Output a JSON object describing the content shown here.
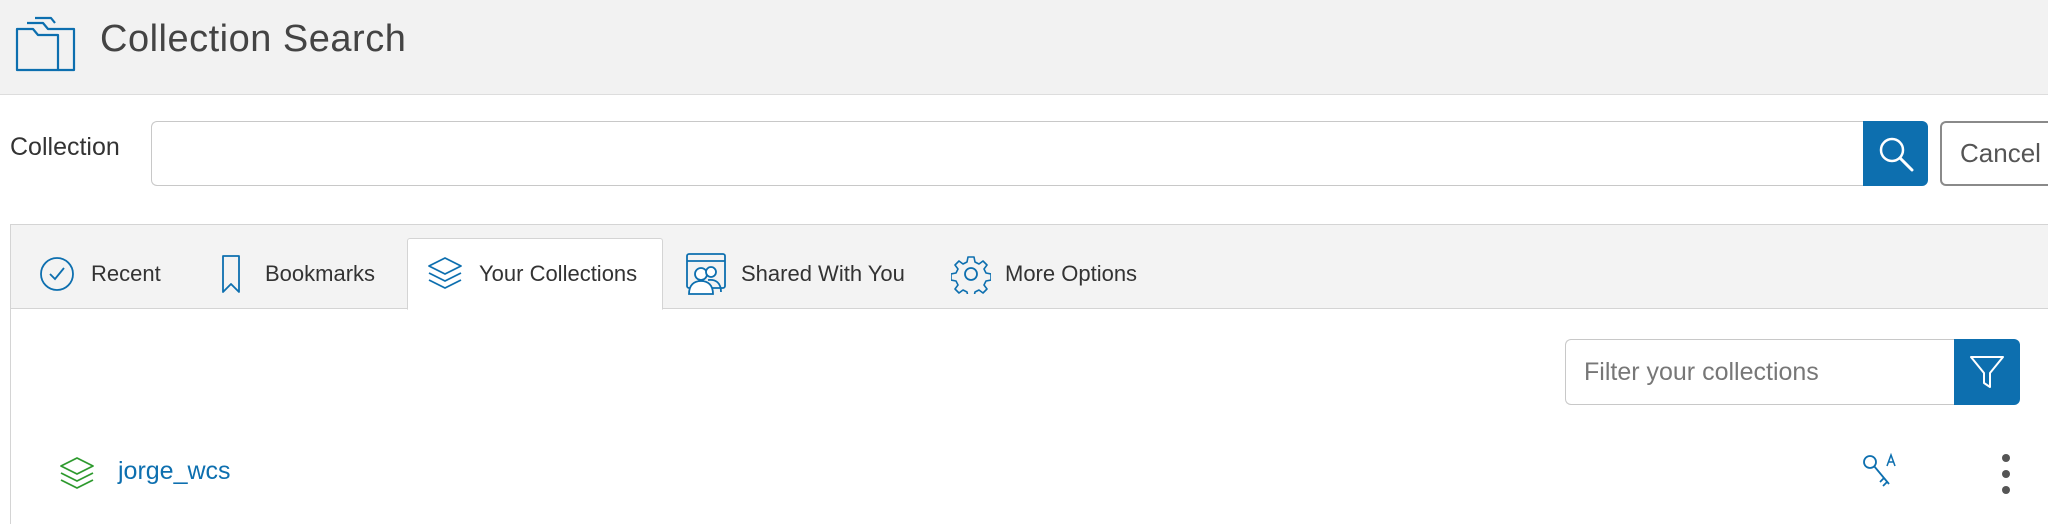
{
  "header": {
    "title": "Collection Search",
    "icon": "folder-icon"
  },
  "search": {
    "label": "Collection",
    "value": "",
    "button_icon": "search-icon",
    "cancel_label": "Cancel"
  },
  "tabs": [
    {
      "label": "Recent",
      "icon": "clock-icon",
      "active": false
    },
    {
      "label": "Bookmarks",
      "icon": "bookmark-icon",
      "active": false
    },
    {
      "label": "Your Collections",
      "icon": "layers-icon",
      "active": true
    },
    {
      "label": "Shared With You",
      "icon": "shared-users-icon",
      "active": false
    },
    {
      "label": "More Options",
      "icon": "gear-icon",
      "active": false
    }
  ],
  "filter": {
    "placeholder": "Filter your collections",
    "button_icon": "filter-icon"
  },
  "collections": [
    {
      "name": "jorge_wcs",
      "icon": "layers-icon",
      "permission_icon": "key-permissions-icon",
      "menu_icon": "more-vertical-icon"
    }
  ],
  "colors": {
    "accent": "#0d6faf",
    "collection_icon": "#2e9a2e",
    "header_bg": "#f2f2f2"
  }
}
